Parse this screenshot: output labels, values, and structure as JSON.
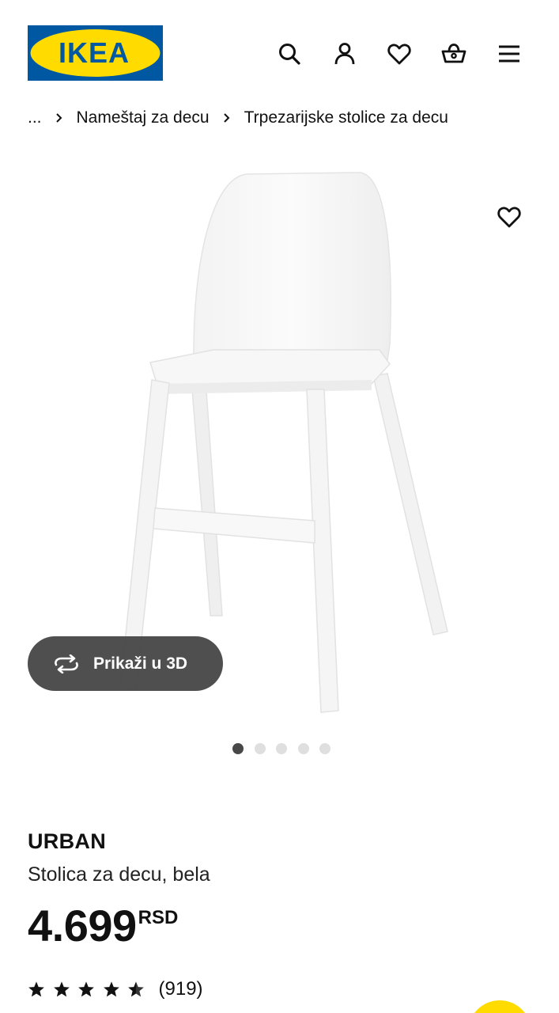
{
  "header": {
    "logo_text": "IKEA",
    "logo_colors": {
      "blue": "#0058a3",
      "yellow": "#ffdb00"
    },
    "icons": [
      "search-icon",
      "user-icon",
      "heart-icon",
      "basket-icon",
      "menu-icon"
    ]
  },
  "breadcrumb": {
    "items": [
      "...",
      "Nameštaj za decu",
      "Trpezarijske stolice za decu"
    ]
  },
  "gallery": {
    "button_3d_label": "Prikaži u 3D",
    "dots_total": 5,
    "active_index": 0
  },
  "product": {
    "name": "URBAN",
    "description": "Stolica za decu, bela",
    "price": "4.699",
    "currency": "RSD",
    "rating_stars": 5,
    "review_count": "(919)"
  }
}
